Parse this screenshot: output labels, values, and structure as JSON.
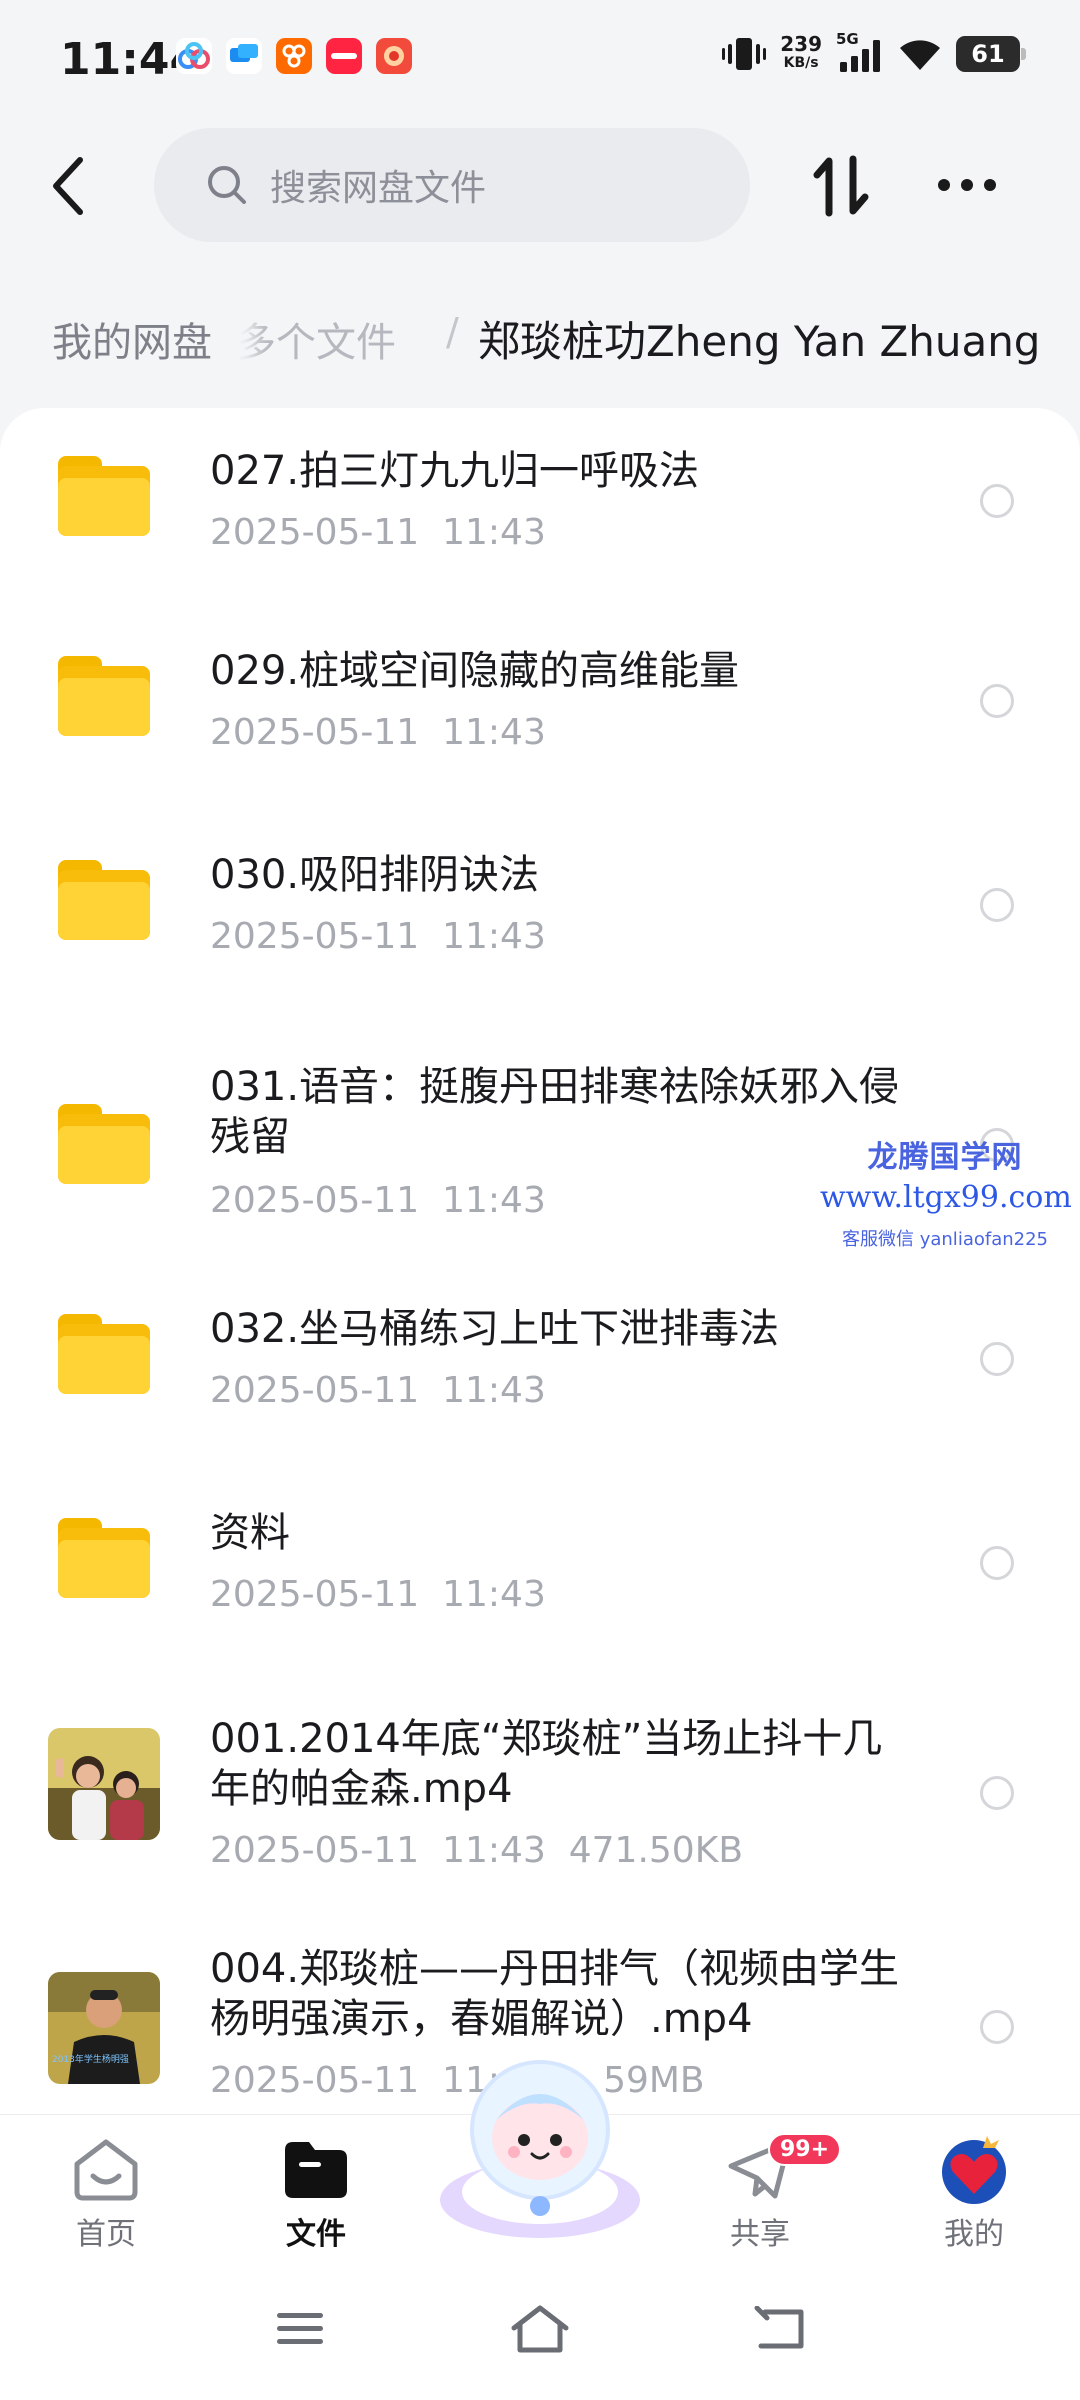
{
  "status_bar": {
    "time": "11:44",
    "network_speed_value": "239",
    "network_speed_unit": "KB/s",
    "network_type": "5G",
    "battery_level": "61",
    "notification_icons": [
      "baidu-netdisk-icon",
      "message-icon",
      "taobao-icon",
      "xiaohongshu-icon",
      "food-app-icon"
    ]
  },
  "header": {
    "search_placeholder": "搜索网盘文件"
  },
  "breadcrumb": {
    "root": "我的网盘",
    "middle": "等多个文件",
    "separator": "/",
    "current": "郑琰桩功Zheng Yan Zhuang"
  },
  "files": [
    {
      "name": "027.拍三灯九九归一呼吸法",
      "date": "2025-05-11",
      "time": "11:43",
      "size": "",
      "type": "folder"
    },
    {
      "name": "029.桩域空间隐藏的高维能量",
      "date": "2025-05-11",
      "time": "11:43",
      "size": "",
      "type": "folder"
    },
    {
      "name": "030.吸阳排阴诀法",
      "date": "2025-05-11",
      "time": "11:43",
      "size": "",
      "type": "folder"
    },
    {
      "name": "031.语音：挺腹丹田排寒祛除妖邪入侵残留",
      "date": "2025-05-11",
      "time": "11:43",
      "size": "",
      "type": "folder"
    },
    {
      "name": "032.坐马桶练习上吐下泄排毒法",
      "date": "2025-05-11",
      "time": "11:43",
      "size": "",
      "type": "folder"
    },
    {
      "name": "资料",
      "date": "2025-05-11",
      "time": "11:43",
      "size": "",
      "type": "folder"
    },
    {
      "name": "001.2014年底“郑琰桩”当场止抖十几年的帕金森.mp4",
      "date": "2025-05-11",
      "time": "11:43",
      "size": "471.50KB",
      "type": "video"
    },
    {
      "name": "004.郑琰桩——丹田排气（视频由学生杨明强演示，春媚解说）.mp4",
      "date": "2025-05-11",
      "time": "11:4",
      "size": "59MB",
      "type": "video"
    }
  ],
  "thumbnail_text": {
    "video_2": "2013年学生杨明强"
  },
  "watermark": {
    "title": "龙腾国学网",
    "url": "www.ltgx99.com",
    "contact": "客服微信 yanliaofan225"
  },
  "bottom_nav": {
    "home": "首页",
    "files": "文件",
    "share": "共享",
    "share_badge": "99+",
    "mine": "我的"
  },
  "colors": {
    "accent": "#f2385a",
    "folder": "#ffd235",
    "watermark": "#2d58e6"
  }
}
